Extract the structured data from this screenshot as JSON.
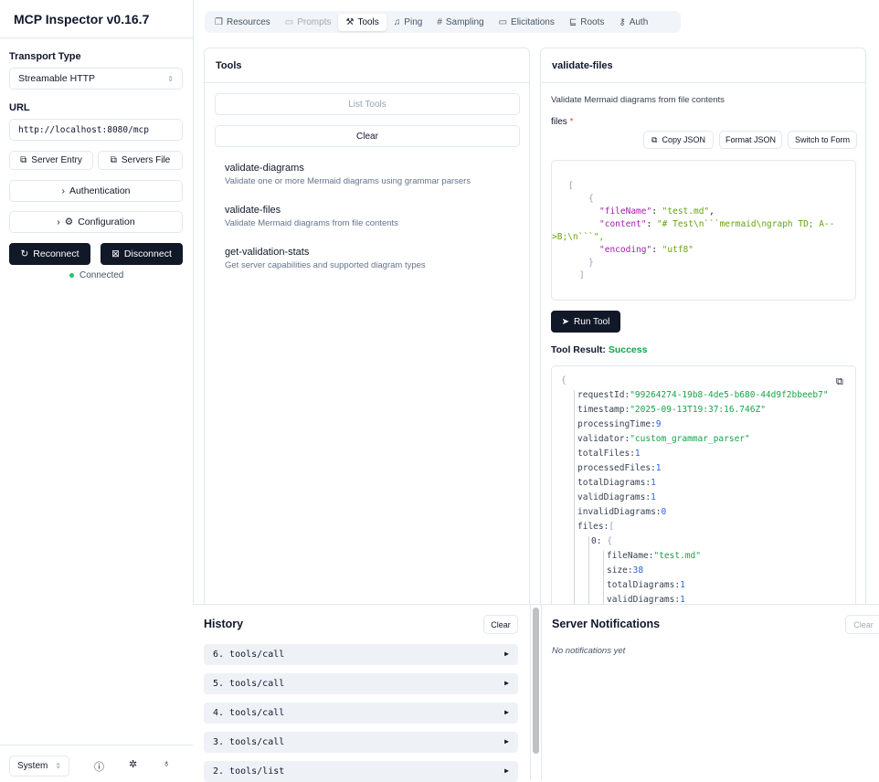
{
  "app": {
    "title": "MCP Inspector v0.16.7"
  },
  "sidebar": {
    "transport_label": "Transport Type",
    "transport_value": "Streamable HTTP",
    "url_label": "URL",
    "url_value": "http://localhost:8080/mcp",
    "server_entry": "Server Entry",
    "servers_file": "Servers File",
    "authentication": "Authentication",
    "configuration": "Configuration",
    "reconnect": "Reconnect",
    "disconnect": "Disconnect",
    "status": "Connected",
    "theme": "System"
  },
  "tabs": [
    "Resources",
    "Prompts",
    "Tools",
    "Ping",
    "Sampling",
    "Elicitations",
    "Roots",
    "Auth"
  ],
  "tools_panel": {
    "title": "Tools",
    "list_tools": "List Tools",
    "clear": "Clear",
    "tools": [
      {
        "name": "validate-diagrams",
        "desc": "Validate one or more Mermaid diagrams using grammar parsers"
      },
      {
        "name": "validate-files",
        "desc": "Validate Mermaid diagrams from file contents"
      },
      {
        "name": "get-validation-stats",
        "desc": "Get server capabilities and supported diagram types"
      }
    ]
  },
  "detail": {
    "title": "validate-files",
    "desc": "Validate Mermaid diagrams from file contents",
    "param_label": "files",
    "required": "*",
    "copy_json": "Copy JSON",
    "format_json": "Format JSON",
    "switch_form": "Switch to Form",
    "input": {
      "fileName": "\"test.md\"",
      "content_1": "\"# Test\\n```mermaid\\ngraph TD; A--",
      "content_2": ">B;\\n```\"",
      "encoding": "\"utf8\""
    },
    "run_tool": "Run Tool",
    "result_label": "Tool Result:",
    "result_status": "Success",
    "result": [
      {
        "k": "requestId:",
        "v": "\"99264274-19b8-4de5-b680-44d9f2bbeeb7\"",
        "t": "s"
      },
      {
        "k": "timestamp:",
        "v": "\"2025-09-13T19:37:16.746Z\"",
        "t": "s"
      },
      {
        "k": "processingTime:",
        "v": "9",
        "t": "n"
      },
      {
        "k": "validator:",
        "v": "\"custom_grammar_parser\"",
        "t": "s"
      },
      {
        "k": "totalFiles:",
        "v": "1",
        "t": "n"
      },
      {
        "k": "processedFiles:",
        "v": "1",
        "t": "n"
      },
      {
        "k": "totalDiagrams:",
        "v": "1",
        "t": "n"
      },
      {
        "k": "validDiagrams:",
        "v": "1",
        "t": "n"
      },
      {
        "k": "invalidDiagrams:",
        "v": "0",
        "t": "n"
      },
      {
        "k": "files:",
        "v": "[",
        "t": "p"
      }
    ],
    "file0": [
      {
        "k": "fileName:",
        "v": "\"test.md\"",
        "t": "s"
      },
      {
        "k": "size:",
        "v": "38",
        "t": "n"
      },
      {
        "k": "totalDiagrams:",
        "v": "1",
        "t": "n"
      },
      {
        "k": "validDiagrams:",
        "v": "1",
        "t": "n"
      }
    ]
  },
  "history": {
    "title": "History",
    "clear": "Clear",
    "items": [
      "6. tools/call",
      "5. tools/call",
      "4. tools/call",
      "3. tools/call",
      "2. tools/list"
    ]
  },
  "notifications": {
    "title": "Server Notifications",
    "clear": "Clear",
    "empty": "No notifications yet"
  }
}
